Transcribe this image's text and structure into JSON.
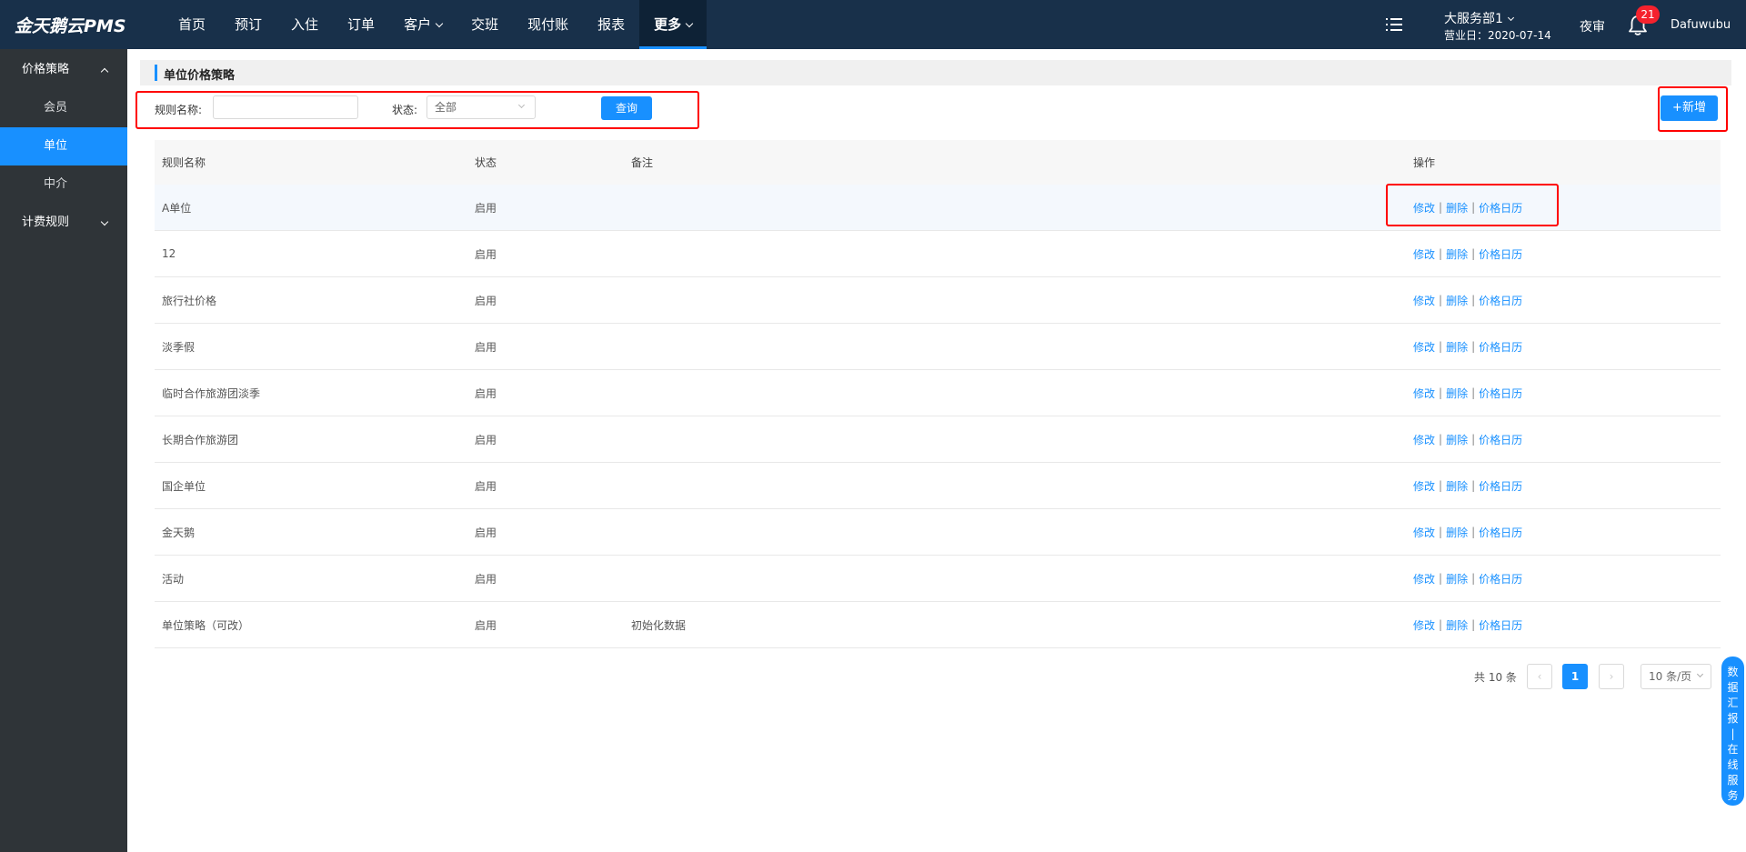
{
  "app": {
    "logo": "金天鹅云PMS"
  },
  "nav": {
    "items": [
      {
        "label": "首页"
      },
      {
        "label": "预订"
      },
      {
        "label": "入住"
      },
      {
        "label": "订单"
      },
      {
        "label": "客户"
      },
      {
        "label": "交班"
      },
      {
        "label": "现付账"
      },
      {
        "label": "报表"
      },
      {
        "label": "更多"
      }
    ],
    "department": "大服务部1",
    "business_date": "营业日：2020-07-14",
    "night_audit": "夜审",
    "notification_count": "21",
    "username": "Dafuwubu"
  },
  "sidebar": {
    "group_price": "价格策略",
    "item_member": "会员",
    "item_unit": "单位",
    "item_agent": "中介",
    "group_billing": "计费规则"
  },
  "page": {
    "title": "单位价格策略",
    "filter_name_label": "规则名称:",
    "filter_name_value": "",
    "filter_status_label": "状态:",
    "filter_status_value": "全部",
    "query_button": "查询",
    "add_button": "+新增"
  },
  "table": {
    "headers": {
      "name": "规则名称",
      "status": "状态",
      "remark": "备注",
      "ops": "操作"
    },
    "op_labels": {
      "edit": "修改",
      "delete": "删除",
      "calendar": "价格日历",
      "sep": "|"
    },
    "rows": [
      {
        "name": "A单位",
        "status": "启用",
        "remark": ""
      },
      {
        "name": "12",
        "status": "启用",
        "remark": ""
      },
      {
        "name": "旅行社价格",
        "status": "启用",
        "remark": ""
      },
      {
        "name": "淡季假",
        "status": "启用",
        "remark": ""
      },
      {
        "name": "临时合作旅游团淡季",
        "status": "启用",
        "remark": ""
      },
      {
        "name": "长期合作旅游团",
        "status": "启用",
        "remark": ""
      },
      {
        "name": "国企单位",
        "status": "启用",
        "remark": ""
      },
      {
        "name": "金天鹅",
        "status": "启用",
        "remark": ""
      },
      {
        "name": "活动",
        "status": "启用",
        "remark": ""
      },
      {
        "name": "单位策略（可改）",
        "status": "启用",
        "remark": "初始化数据"
      }
    ]
  },
  "pagination": {
    "total": "共 10 条",
    "current": "1",
    "prev": "‹",
    "next": "›",
    "page_size": "10 条/页"
  },
  "float_service": {
    "chars": [
      "数",
      "据",
      "汇",
      "报",
      "|",
      "在",
      "线",
      "服",
      "务"
    ]
  },
  "colors": {
    "topbar": "#18304a",
    "sidebar": "#2f3438",
    "accent": "#1890ff",
    "highlight": "#f00"
  }
}
